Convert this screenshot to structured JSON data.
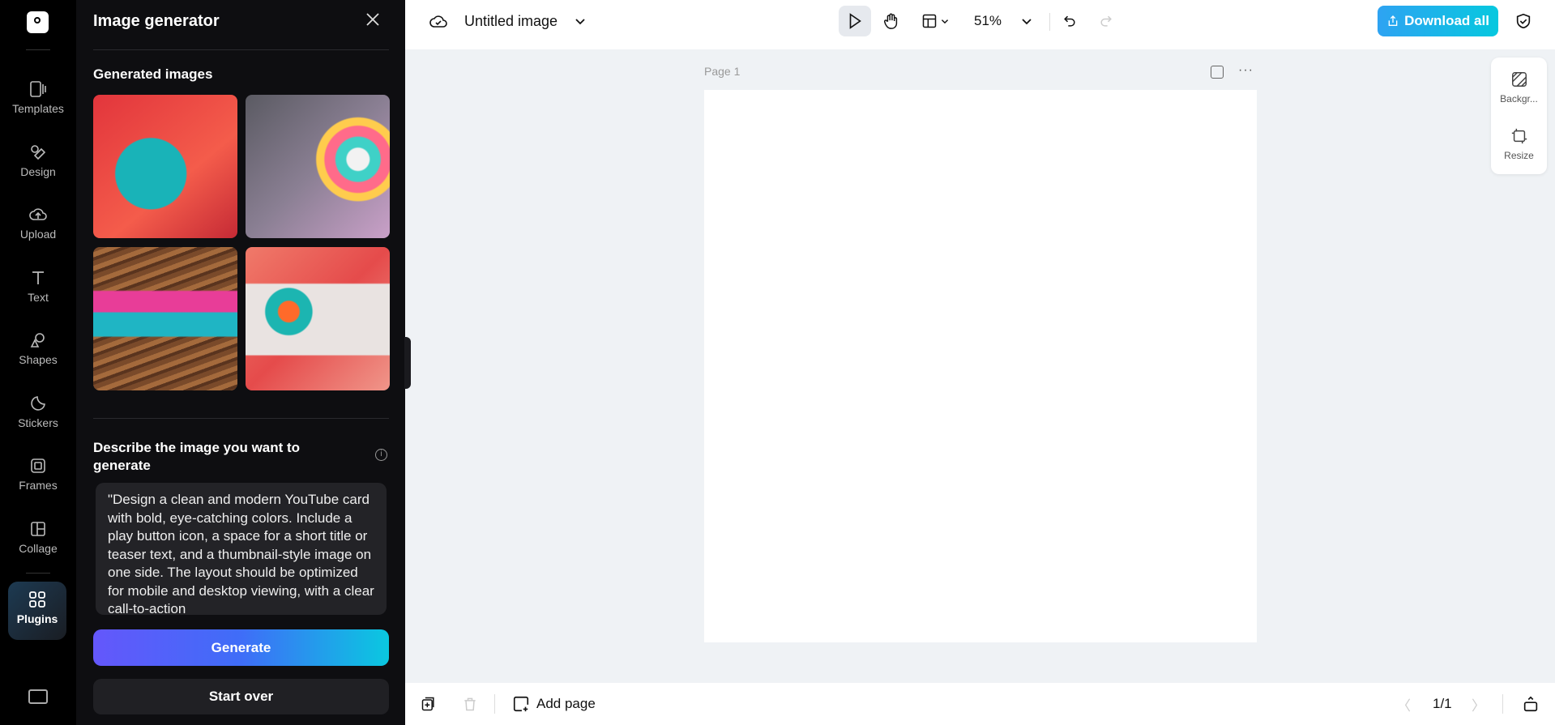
{
  "rail": {
    "items": [
      {
        "label": "Templates",
        "icon": "templates-icon"
      },
      {
        "label": "Design",
        "icon": "design-icon"
      },
      {
        "label": "Upload",
        "icon": "upload-icon"
      },
      {
        "label": "Text",
        "icon": "text-icon"
      },
      {
        "label": "Shapes",
        "icon": "shapes-icon"
      },
      {
        "label": "Stickers",
        "icon": "stickers-icon"
      },
      {
        "label": "Frames",
        "icon": "frames-icon"
      },
      {
        "label": "Collage",
        "icon": "collage-icon"
      }
    ],
    "active": {
      "label": "Plugins",
      "icon": "plugins-icon"
    }
  },
  "panel": {
    "title": "Image generator",
    "generated_label": "Generated images",
    "describe_label": "Describe the image you want to generate",
    "prompt": "\"Design a clean and modern YouTube card with bold, eye-catching colors. Include a play button icon, a space for a short title or teaser text, and a thumbnail-style image on one side. The layout should be optimized for mobile and desktop viewing, with a clear call-to-action",
    "generate_label": "Generate",
    "start_over_label": "Start over"
  },
  "topbar": {
    "title": "Untitled image",
    "zoom": "51%",
    "download_label": "Download all"
  },
  "canvas": {
    "page_label": "Page 1"
  },
  "right_panel": {
    "background_label": "Backgr...",
    "resize_label": "Resize"
  },
  "bottom": {
    "add_page_label": "Add page",
    "pager": "1/1"
  },
  "colors": {
    "accent_start": "#2ea3f2",
    "accent_end": "#06c8df",
    "generate_start": "#6457fb",
    "generate_end": "#0ac8e0"
  }
}
